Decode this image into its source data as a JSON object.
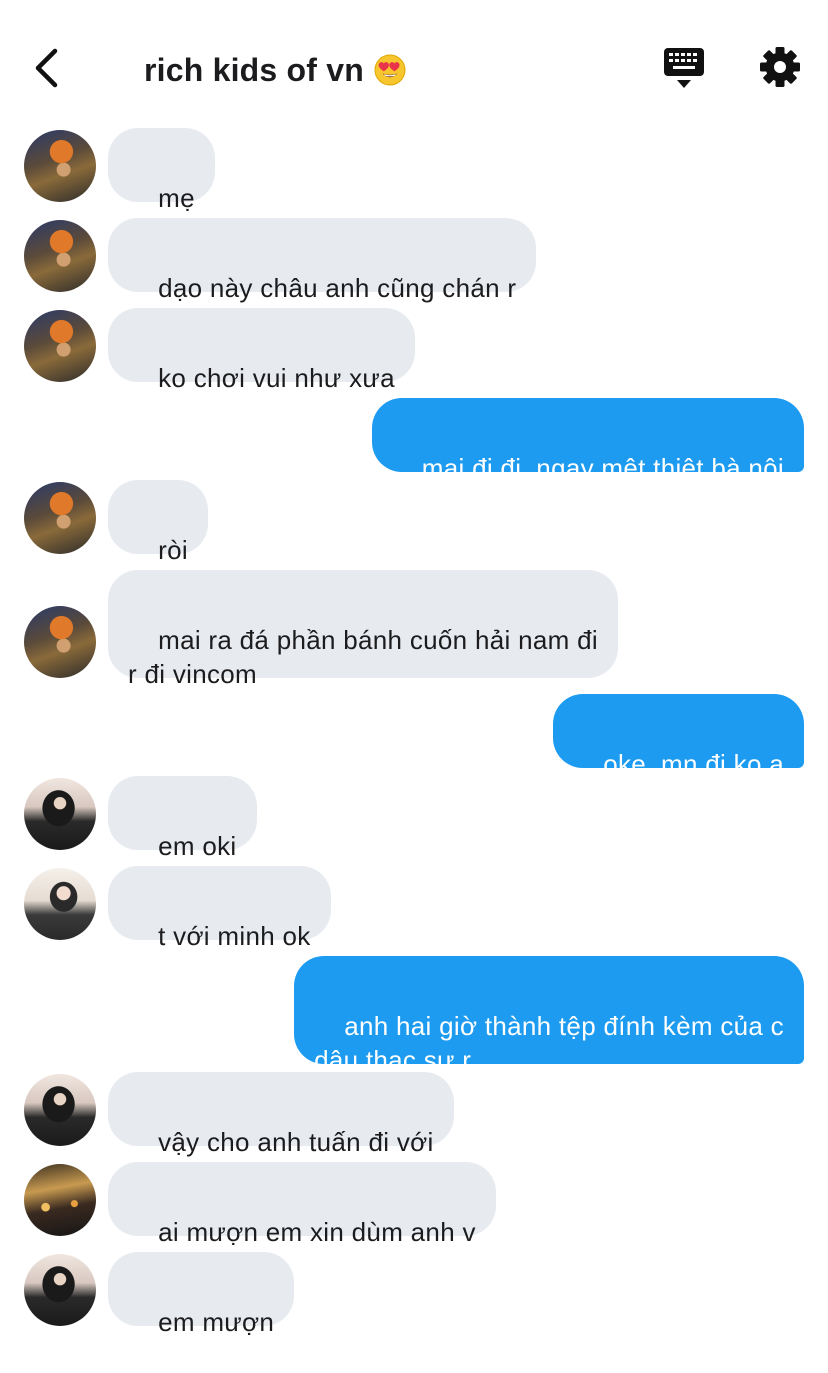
{
  "header": {
    "title": "rich kids of vn",
    "title_emoji": "heart-eyes-emoji",
    "back_icon": "chevron-left-icon",
    "keyboard_icon": "keyboard-icon",
    "settings_icon": "gear-icon"
  },
  "colors": {
    "incoming_bubble": "#e7ebf0",
    "outgoing_bubble": "#1d9bf0",
    "text": "#1c1c1e"
  },
  "messages": [
    {
      "direction": "in",
      "avatar": "avatar-a",
      "text": "mẹ"
    },
    {
      "direction": "in",
      "avatar": "avatar-a",
      "text": "dạo này châu anh cũng chán r"
    },
    {
      "direction": "in",
      "avatar": "avatar-a",
      "text": "ko chơi vui như xưa"
    },
    {
      "direction": "out",
      "text": "mai đi đi, ngay mệt thiệt bà nội"
    },
    {
      "direction": "in",
      "avatar": "avatar-a",
      "text": "ròi"
    },
    {
      "direction": "in",
      "avatar": "avatar-a",
      "text": "mai ra đá phần bánh cuốn hải nam đi\nr đi vincom"
    },
    {
      "direction": "out",
      "text": "oke, mn đi ko ạ"
    },
    {
      "direction": "in",
      "avatar": "avatar-b",
      "text": "em oki"
    },
    {
      "direction": "in",
      "avatar": "avatar-c",
      "text": "t với minh ok"
    },
    {
      "direction": "out",
      "text": "anh hai giờ thành tệp đính kèm của c\ndâu thạc sự r"
    },
    {
      "direction": "in",
      "avatar": "avatar-b",
      "text": "vậy cho anh tuấn đi với"
    },
    {
      "direction": "in",
      "avatar": "avatar-d",
      "text": "ai mượn em xin dùm anh v"
    },
    {
      "direction": "in",
      "avatar": "avatar-b",
      "text": "em mượn"
    }
  ]
}
